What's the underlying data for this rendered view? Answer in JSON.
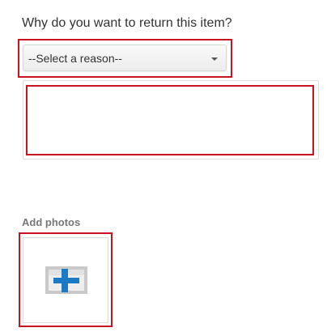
{
  "question": "Why do you want to return this item?",
  "reason_select": {
    "selected": "--Select a reason--"
  },
  "details_textarea": {
    "value": ""
  },
  "photos": {
    "label": "Add photos"
  },
  "icons": {
    "select_caret": "caret-down-icon",
    "add_photo": "add-photo-plus-icon"
  },
  "colors": {
    "highlight": "#c8141e",
    "plus_blue": "#1a7ac4",
    "label_gray": "#777777"
  }
}
